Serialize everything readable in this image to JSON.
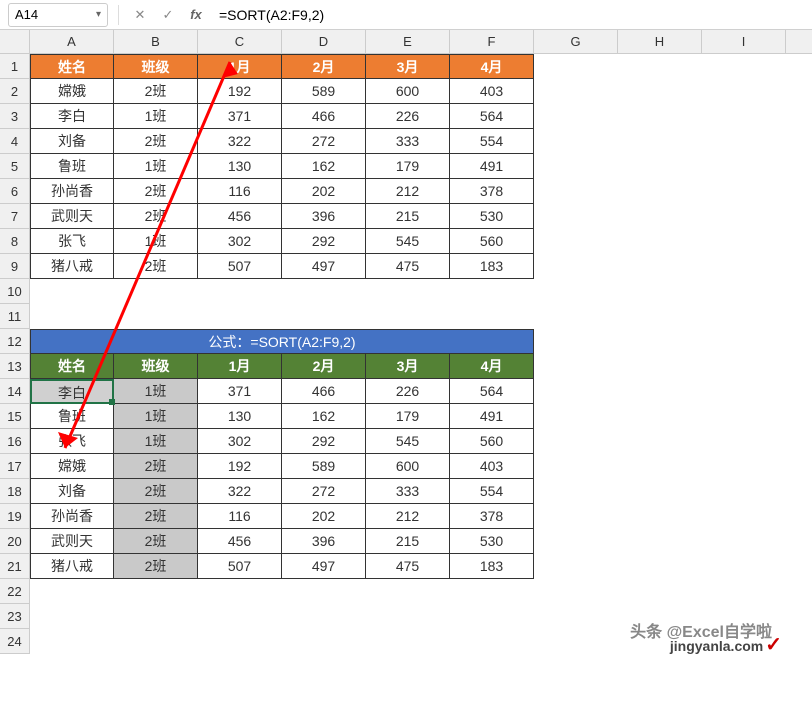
{
  "formulaBar": {
    "nameBox": "A14",
    "formula": "=SORT(A2:F9,2)"
  },
  "columns": [
    "A",
    "B",
    "C",
    "D",
    "E",
    "F",
    "G",
    "H",
    "I"
  ],
  "rows": [
    "1",
    "2",
    "3",
    "4",
    "5",
    "6",
    "7",
    "8",
    "9",
    "10",
    "11",
    "12",
    "13",
    "14",
    "15",
    "16",
    "17",
    "18",
    "19",
    "20",
    "21",
    "22",
    "23",
    "24"
  ],
  "table1": {
    "headers": [
      "姓名",
      "班级",
      "1月",
      "2月",
      "3月",
      "4月"
    ],
    "data": [
      [
        "嫦娥",
        "2班",
        "192",
        "589",
        "600",
        "403"
      ],
      [
        "李白",
        "1班",
        "371",
        "466",
        "226",
        "564"
      ],
      [
        "刘备",
        "2班",
        "322",
        "272",
        "333",
        "554"
      ],
      [
        "鲁班",
        "1班",
        "130",
        "162",
        "179",
        "491"
      ],
      [
        "孙尚香",
        "2班",
        "116",
        "202",
        "212",
        "378"
      ],
      [
        "武则天",
        "2班",
        "456",
        "396",
        "215",
        "530"
      ],
      [
        "张飞",
        "1班",
        "302",
        "292",
        "545",
        "560"
      ],
      [
        "猪八戒",
        "2班",
        "507",
        "497",
        "475",
        "183"
      ]
    ]
  },
  "formulaTitle": "公式：=SORT(A2:F9,2)",
  "table2": {
    "headers": [
      "姓名",
      "班级",
      "1月",
      "2月",
      "3月",
      "4月"
    ],
    "data": [
      [
        "李白",
        "1班",
        "371",
        "466",
        "226",
        "564"
      ],
      [
        "鲁班",
        "1班",
        "130",
        "162",
        "179",
        "491"
      ],
      [
        "张飞",
        "1班",
        "302",
        "292",
        "545",
        "560"
      ],
      [
        "嫦娥",
        "2班",
        "192",
        "589",
        "600",
        "403"
      ],
      [
        "刘备",
        "2班",
        "322",
        "272",
        "333",
        "554"
      ],
      [
        "孙尚香",
        "2班",
        "116",
        "202",
        "212",
        "378"
      ],
      [
        "武则天",
        "2班",
        "456",
        "396",
        "215",
        "530"
      ],
      [
        "猪八戒",
        "2班",
        "507",
        "497",
        "475",
        "183"
      ]
    ]
  },
  "watermark1": "头条 @Excel自学啦",
  "watermark2": "jingyanla.com"
}
